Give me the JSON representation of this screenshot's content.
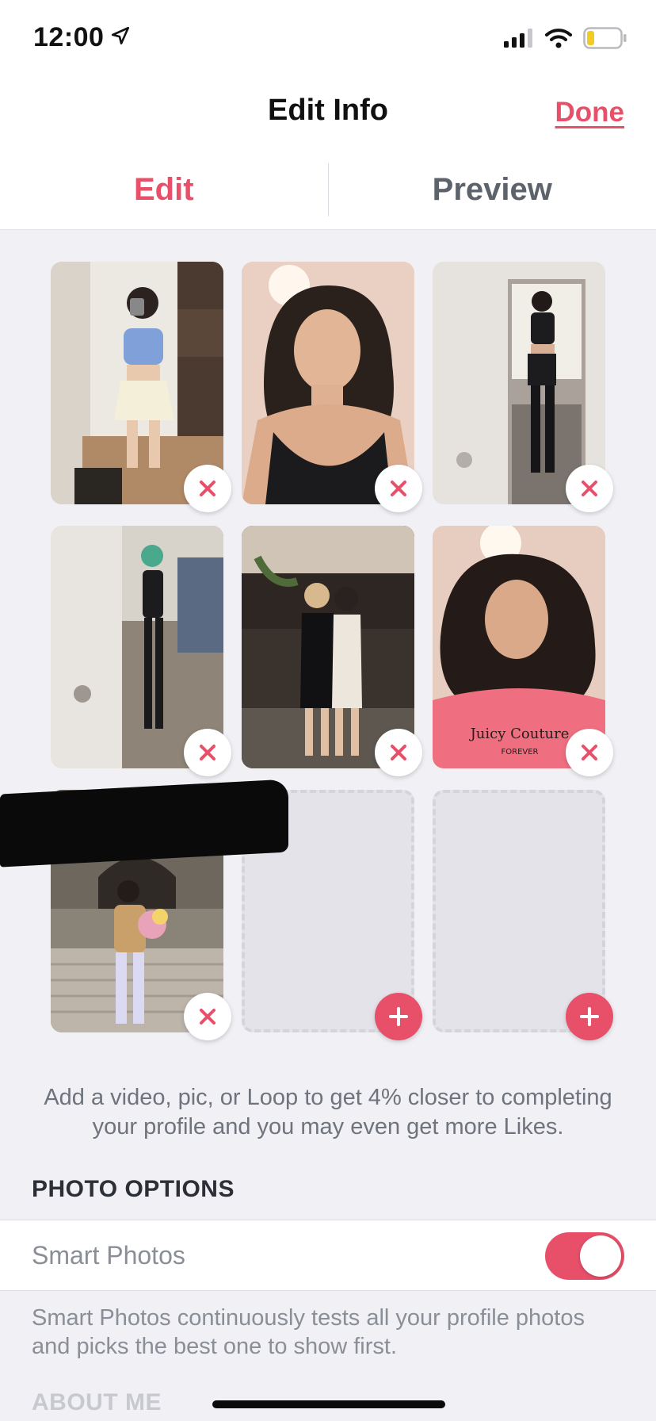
{
  "status_bar": {
    "time": "12:00",
    "location_icon": "location-arrow-icon",
    "signal_icon": "signal-icon",
    "wifi_icon": "wifi-icon",
    "battery_icon": "battery-low-icon"
  },
  "header": {
    "title": "Edit Info",
    "done_label": "Done"
  },
  "tabs": [
    {
      "label": "Edit",
      "active": true
    },
    {
      "label": "Preview",
      "active": false
    }
  ],
  "photos": {
    "filled_count": 7,
    "empty_count": 2,
    "remove_icon": "close-icon",
    "add_icon": "plus-icon"
  },
  "hint": "Add a video, pic, or Loop to get 4% closer to completing your profile and you may even get more Likes.",
  "photo_options": {
    "section_title": "PHOTO OPTIONS",
    "smart_photos_label": "Smart Photos",
    "smart_photos_enabled": true,
    "smart_photos_description": "Smart Photos continuously tests all your profile photos and picks the best one to show first."
  },
  "about_me": {
    "section_title": "ABOUT ME"
  },
  "colors": {
    "accent": "#e8506a",
    "background": "#f0f0f5"
  }
}
